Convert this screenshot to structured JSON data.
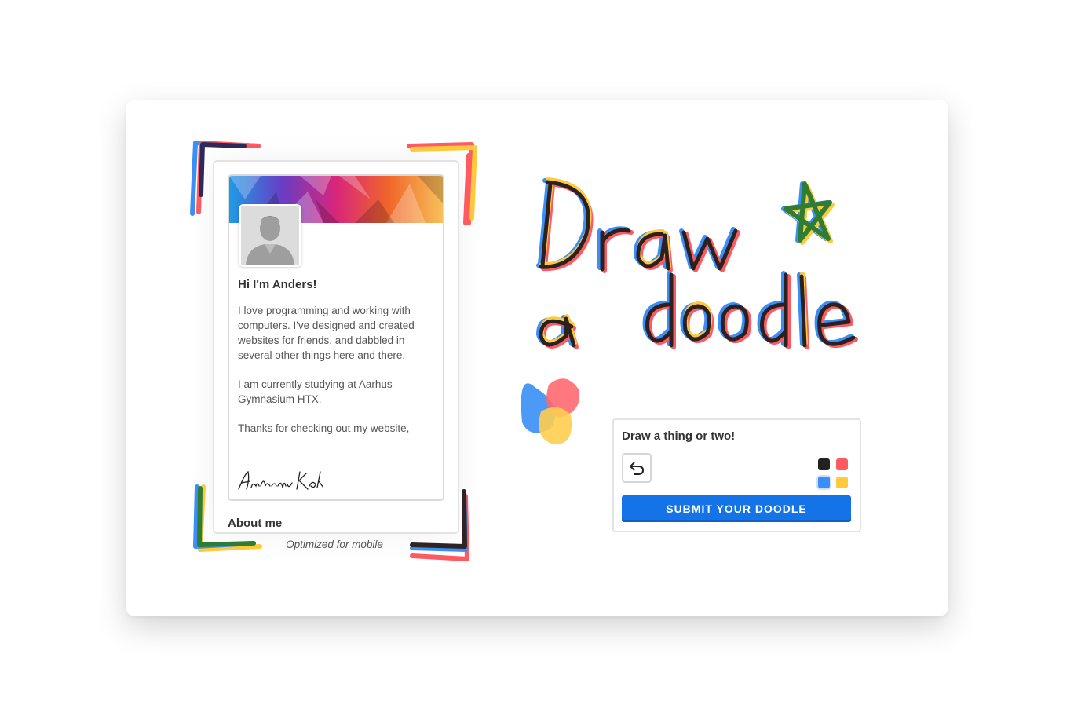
{
  "profile": {
    "greeting": "Hi I'm Anders!",
    "bio": [
      "I love programming and working with computers. I've designed and created websites for friends, and dabbled in several other things here and there.",
      "I am currently studying at Aarhus Gymnasium HTX.",
      "Thanks for checking out my website,"
    ],
    "signature": "Anders Kok",
    "about_heading": "About me"
  },
  "caption": "Optimized for mobile",
  "headline": {
    "line1": "Draw",
    "line2": "a doodle"
  },
  "doodle_panel": {
    "prompt": "Draw a thing or two!",
    "submit_label": "SUBMIT YOUR DOODLE",
    "undo_icon": "undo-icon",
    "colors": [
      "#222222",
      "#ff5a5f",
      "#3a8ef6",
      "#ffc93c"
    ],
    "selected_color": "#3a8ef6"
  },
  "palette": {
    "blue": "#1473e6",
    "red": "#ff5a5f",
    "yellow": "#ffc93c",
    "green": "#2e7d32",
    "ink": "#222222"
  }
}
